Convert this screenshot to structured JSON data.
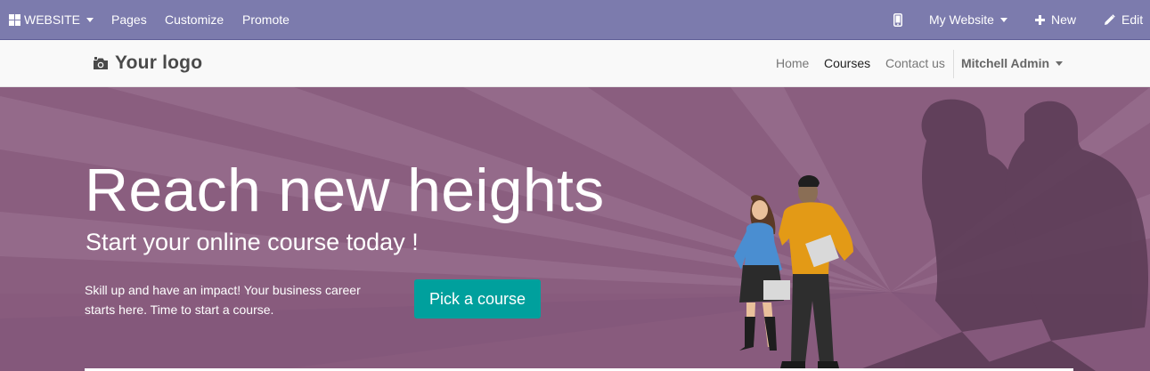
{
  "admin_bar": {
    "website_menu": "WEBSITE",
    "pages": "Pages",
    "customize": "Customize",
    "promote": "Promote",
    "my_website": "My Website",
    "new": "New",
    "edit": "Edit"
  },
  "header": {
    "logo_text": "Your logo",
    "nav": [
      "Home",
      "Courses",
      "Contact us"
    ],
    "active_nav": "Courses",
    "user": "Mitchell Admin"
  },
  "hero": {
    "title": "Reach new heights",
    "subtitle": "Start your online course today !",
    "description": "Skill up and have an impact! Your business career starts here. Time to start a course.",
    "cta_label": "Pick a course"
  },
  "colors": {
    "admin_bar": "#7c7bad",
    "hero_bg": "#8a5e7f",
    "cta": "#00a09d"
  }
}
